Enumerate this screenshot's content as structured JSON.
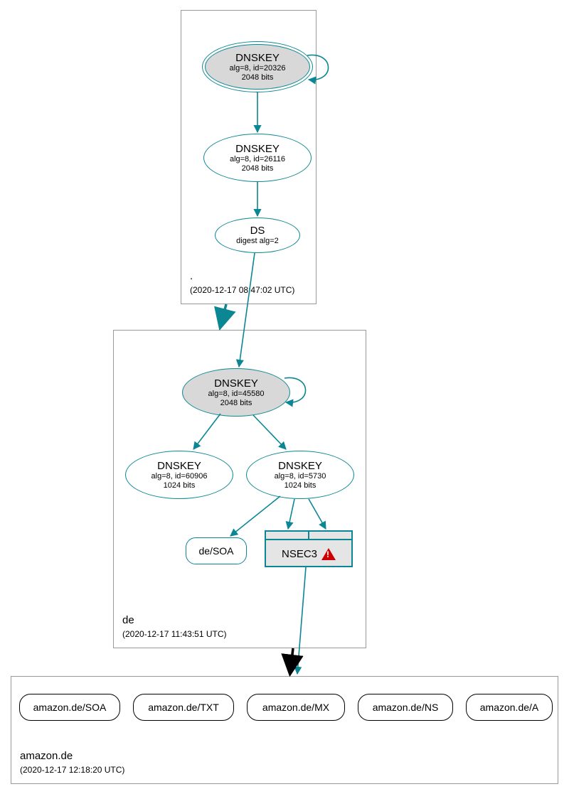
{
  "accent": "#0b8793",
  "zones": {
    "root": {
      "name": ".",
      "timestamp": "(2020-12-17 08:47:02 UTC)",
      "nodes": {
        "ksk": {
          "title": "DNSKEY",
          "sub1": "alg=8, id=20326",
          "sub2": "2048 bits"
        },
        "zsk": {
          "title": "DNSKEY",
          "sub1": "alg=8, id=26116",
          "sub2": "2048 bits"
        },
        "ds": {
          "title": "DS",
          "sub1": "digest alg=2"
        }
      }
    },
    "de": {
      "name": "de",
      "timestamp": "(2020-12-17 11:43:51 UTC)",
      "nodes": {
        "ksk": {
          "title": "DNSKEY",
          "sub1": "alg=8, id=45580",
          "sub2": "2048 bits"
        },
        "zsk1": {
          "title": "DNSKEY",
          "sub1": "alg=8, id=60906",
          "sub2": "1024 bits"
        },
        "zsk2": {
          "title": "DNSKEY",
          "sub1": "alg=8, id=5730",
          "sub2": "1024 bits"
        },
        "soa": {
          "label": "de/SOA"
        },
        "nsec3": {
          "label": "NSEC3"
        }
      }
    },
    "amazon": {
      "name": "amazon.de",
      "timestamp": "(2020-12-17 12:18:20 UTC)",
      "records": [
        "amazon.de/SOA",
        "amazon.de/TXT",
        "amazon.de/MX",
        "amazon.de/NS",
        "amazon.de/A"
      ]
    }
  }
}
